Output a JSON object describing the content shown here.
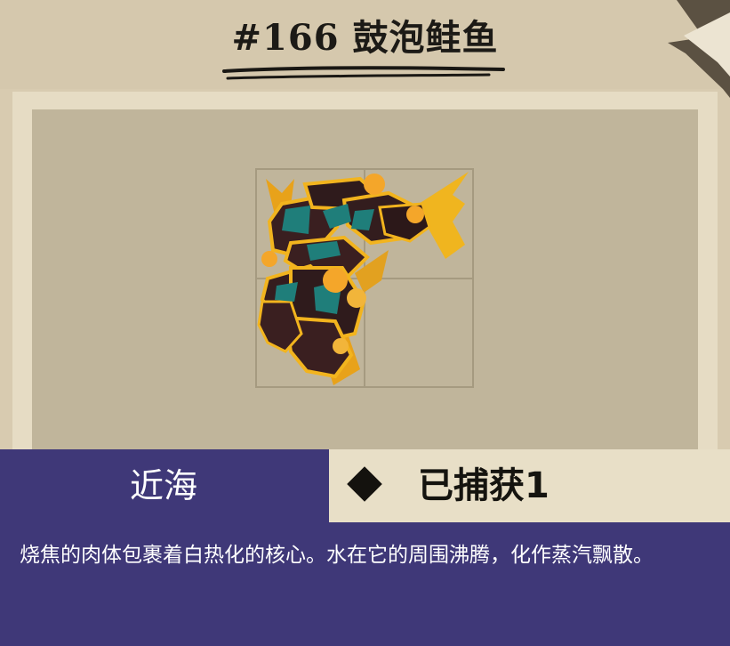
{
  "header": {
    "title_number": "#166",
    "title_name": "鼓泡鲑鱼"
  },
  "fish": {
    "image": "bubbling-salmon-fish-sprite",
    "grid_cells": 4
  },
  "info": {
    "region": "近海",
    "status_icon": "diamond-icon",
    "status": "已捕获1",
    "description": "烧焦的肉体包裹着白热化的核心。水在它的周围沸腾，化作蒸汽飘散。"
  },
  "colors": {
    "parchment": "#d8cbb0",
    "panel": "#c0b59b",
    "info_bar": "#3f3878",
    "status_bg": "#e8dfc7"
  }
}
